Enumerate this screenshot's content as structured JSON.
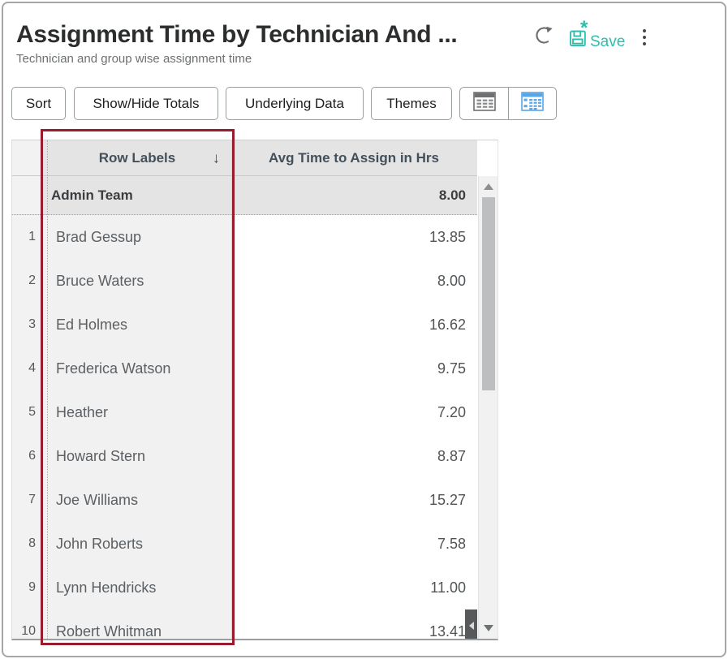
{
  "page": {
    "title": "Assignment Time by Technician And ...",
    "subtitle": "Technician and group wise assignment time"
  },
  "header_actions": {
    "refresh_icon": "circular-refresh-arrow",
    "save_label": "Save",
    "save_asterisk": "*",
    "save_icon": "floppy-save-with-asterisk",
    "menu_icon": "vertical-kebab-dots",
    "accent_color": "#2abfab"
  },
  "toolbar": {
    "buttons": [
      {
        "label": "Sort"
      },
      {
        "label": "Show/Hide Totals"
      },
      {
        "label": "Underlying Data"
      },
      {
        "label": "Themes"
      }
    ],
    "view_switcher": [
      {
        "icon": "table-view-grid",
        "color": "#6e7072"
      },
      {
        "icon": "pivot-view-grid",
        "color": "#57a7e8"
      }
    ]
  },
  "table": {
    "columns": [
      {
        "label": "Row Labels",
        "sort_indicator": "↓"
      },
      {
        "label": "Avg Time to Assign in Hrs"
      }
    ],
    "total_row": {
      "label": "Admin Team",
      "value": "8.00"
    },
    "rows": [
      {
        "num": "1",
        "label": "Brad Gessup",
        "value": "13.85"
      },
      {
        "num": "2",
        "label": "Bruce Waters",
        "value": "8.00"
      },
      {
        "num": "3",
        "label": "Ed Holmes",
        "value": "16.62"
      },
      {
        "num": "4",
        "label": "Frederica Watson",
        "value": "9.75"
      },
      {
        "num": "5",
        "label": "Heather",
        "value": "7.20"
      },
      {
        "num": "6",
        "label": "Howard Stern",
        "value": "8.87"
      },
      {
        "num": "7",
        "label": "Joe Williams",
        "value": "15.27"
      },
      {
        "num": "8",
        "label": "John Roberts",
        "value": "7.58"
      },
      {
        "num": "9",
        "label": "Lynn Hendricks",
        "value": "11.00"
      },
      {
        "num": "10",
        "label": "Robert Whitman",
        "value": "13.41"
      }
    ],
    "highlight_color": "#9b1b2e",
    "scrollbar_icons": {
      "up": "triangle-up",
      "down": "triangle-down",
      "left": "triangle-left"
    }
  }
}
